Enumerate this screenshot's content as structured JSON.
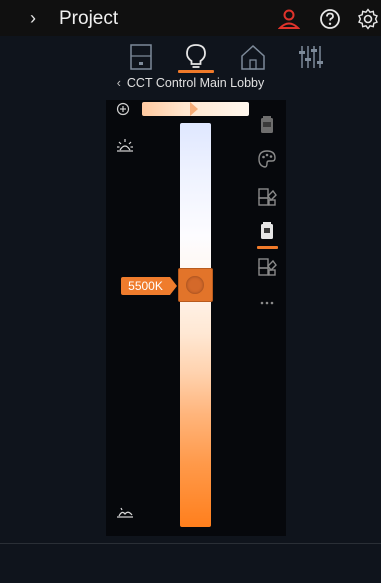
{
  "header": {
    "expand_glyph": "›",
    "title": "Project",
    "icons": [
      "user-icon",
      "help-icon",
      "settings-icon"
    ],
    "user_icon_color": "#e0332b"
  },
  "tabs": [
    {
      "name": "device",
      "icon": "device-icon",
      "active": false
    },
    {
      "name": "light",
      "icon": "bulb-icon",
      "active": true
    },
    {
      "name": "space",
      "icon": "house-icon",
      "active": false
    },
    {
      "name": "controls",
      "icon": "sliders-icon",
      "active": false
    }
  ],
  "breadcrumb": {
    "back_glyph": "‹",
    "label": "CCT Control Main Lobby"
  },
  "cct": {
    "value_label": "5500K",
    "slider_position": 0.4
  },
  "side_tools": [
    "fixture-icon",
    "palette-icon",
    "scene-icon",
    "usb-fixture-icon",
    "scene-grid-icon",
    "more-icon"
  ],
  "active_side_tool": "usb-fixture-icon",
  "colors": {
    "accent": "#f07a2a",
    "background": "#0f141c",
    "panel": "#06080c"
  }
}
